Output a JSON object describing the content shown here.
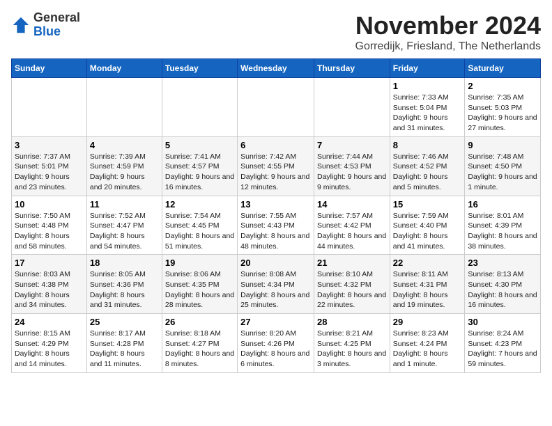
{
  "logo": {
    "general": "General",
    "blue": "Blue"
  },
  "header": {
    "month": "November 2024",
    "location": "Gorredijk, Friesland, The Netherlands"
  },
  "weekdays": [
    "Sunday",
    "Monday",
    "Tuesday",
    "Wednesday",
    "Thursday",
    "Friday",
    "Saturday"
  ],
  "weeks": [
    [
      {
        "day": "",
        "info": ""
      },
      {
        "day": "",
        "info": ""
      },
      {
        "day": "",
        "info": ""
      },
      {
        "day": "",
        "info": ""
      },
      {
        "day": "",
        "info": ""
      },
      {
        "day": "1",
        "info": "Sunrise: 7:33 AM\nSunset: 5:04 PM\nDaylight: 9 hours and 31 minutes."
      },
      {
        "day": "2",
        "info": "Sunrise: 7:35 AM\nSunset: 5:03 PM\nDaylight: 9 hours and 27 minutes."
      }
    ],
    [
      {
        "day": "3",
        "info": "Sunrise: 7:37 AM\nSunset: 5:01 PM\nDaylight: 9 hours and 23 minutes."
      },
      {
        "day": "4",
        "info": "Sunrise: 7:39 AM\nSunset: 4:59 PM\nDaylight: 9 hours and 20 minutes."
      },
      {
        "day": "5",
        "info": "Sunrise: 7:41 AM\nSunset: 4:57 PM\nDaylight: 9 hours and 16 minutes."
      },
      {
        "day": "6",
        "info": "Sunrise: 7:42 AM\nSunset: 4:55 PM\nDaylight: 9 hours and 12 minutes."
      },
      {
        "day": "7",
        "info": "Sunrise: 7:44 AM\nSunset: 4:53 PM\nDaylight: 9 hours and 9 minutes."
      },
      {
        "day": "8",
        "info": "Sunrise: 7:46 AM\nSunset: 4:52 PM\nDaylight: 9 hours and 5 minutes."
      },
      {
        "day": "9",
        "info": "Sunrise: 7:48 AM\nSunset: 4:50 PM\nDaylight: 9 hours and 1 minute."
      }
    ],
    [
      {
        "day": "10",
        "info": "Sunrise: 7:50 AM\nSunset: 4:48 PM\nDaylight: 8 hours and 58 minutes."
      },
      {
        "day": "11",
        "info": "Sunrise: 7:52 AM\nSunset: 4:47 PM\nDaylight: 8 hours and 54 minutes."
      },
      {
        "day": "12",
        "info": "Sunrise: 7:54 AM\nSunset: 4:45 PM\nDaylight: 8 hours and 51 minutes."
      },
      {
        "day": "13",
        "info": "Sunrise: 7:55 AM\nSunset: 4:43 PM\nDaylight: 8 hours and 48 minutes."
      },
      {
        "day": "14",
        "info": "Sunrise: 7:57 AM\nSunset: 4:42 PM\nDaylight: 8 hours and 44 minutes."
      },
      {
        "day": "15",
        "info": "Sunrise: 7:59 AM\nSunset: 4:40 PM\nDaylight: 8 hours and 41 minutes."
      },
      {
        "day": "16",
        "info": "Sunrise: 8:01 AM\nSunset: 4:39 PM\nDaylight: 8 hours and 38 minutes."
      }
    ],
    [
      {
        "day": "17",
        "info": "Sunrise: 8:03 AM\nSunset: 4:38 PM\nDaylight: 8 hours and 34 minutes."
      },
      {
        "day": "18",
        "info": "Sunrise: 8:05 AM\nSunset: 4:36 PM\nDaylight: 8 hours and 31 minutes."
      },
      {
        "day": "19",
        "info": "Sunrise: 8:06 AM\nSunset: 4:35 PM\nDaylight: 8 hours and 28 minutes."
      },
      {
        "day": "20",
        "info": "Sunrise: 8:08 AM\nSunset: 4:34 PM\nDaylight: 8 hours and 25 minutes."
      },
      {
        "day": "21",
        "info": "Sunrise: 8:10 AM\nSunset: 4:32 PM\nDaylight: 8 hours and 22 minutes."
      },
      {
        "day": "22",
        "info": "Sunrise: 8:11 AM\nSunset: 4:31 PM\nDaylight: 8 hours and 19 minutes."
      },
      {
        "day": "23",
        "info": "Sunrise: 8:13 AM\nSunset: 4:30 PM\nDaylight: 8 hours and 16 minutes."
      }
    ],
    [
      {
        "day": "24",
        "info": "Sunrise: 8:15 AM\nSunset: 4:29 PM\nDaylight: 8 hours and 14 minutes."
      },
      {
        "day": "25",
        "info": "Sunrise: 8:17 AM\nSunset: 4:28 PM\nDaylight: 8 hours and 11 minutes."
      },
      {
        "day": "26",
        "info": "Sunrise: 8:18 AM\nSunset: 4:27 PM\nDaylight: 8 hours and 8 minutes."
      },
      {
        "day": "27",
        "info": "Sunrise: 8:20 AM\nSunset: 4:26 PM\nDaylight: 8 hours and 6 minutes."
      },
      {
        "day": "28",
        "info": "Sunrise: 8:21 AM\nSunset: 4:25 PM\nDaylight: 8 hours and 3 minutes."
      },
      {
        "day": "29",
        "info": "Sunrise: 8:23 AM\nSunset: 4:24 PM\nDaylight: 8 hours and 1 minute."
      },
      {
        "day": "30",
        "info": "Sunrise: 8:24 AM\nSunset: 4:23 PM\nDaylight: 7 hours and 59 minutes."
      }
    ]
  ]
}
